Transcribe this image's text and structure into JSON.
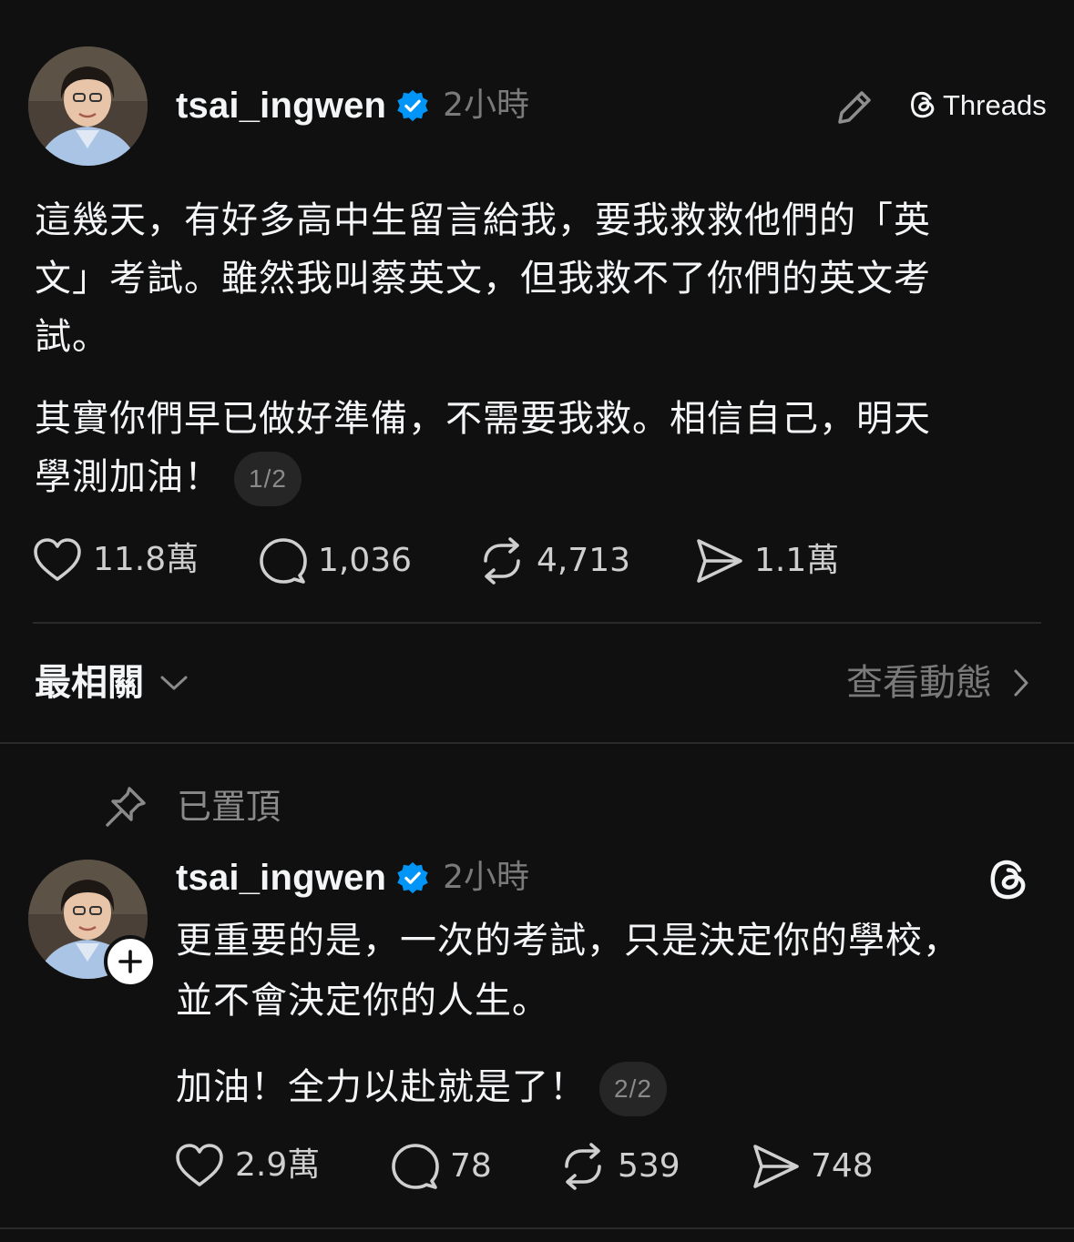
{
  "post1": {
    "username": "tsai_ingwen",
    "time": "2小時",
    "threads_label": "Threads",
    "paragraph1_lines": [
      "這幾天，有好多高中生留言給我，要我救救他們的「英",
      "文」考試。雖然我叫蔡英文，但我救不了你們的英文考",
      "試。"
    ],
    "paragraph2_lines": [
      "其實你們早已做好準備，不需要我救。相信自己，明天",
      "學測加油！"
    ],
    "counter": "1/2",
    "likes": "11.8萬",
    "replies": "1,036",
    "reposts": "4,713",
    "shares": "1.1萬"
  },
  "sort": {
    "label": "最相關",
    "activity_label": "查看動態"
  },
  "post2": {
    "pinned_label": "已置頂",
    "username": "tsai_ingwen",
    "time": "2小時",
    "paragraph1_lines": [
      "更重要的是，一次的考試，只是決定你的學校，",
      "並不會決定你的人生。"
    ],
    "paragraph2": "加油！全力以赴就是了！",
    "counter": "2/2",
    "likes": "2.9萬",
    "replies": "78",
    "reposts": "539",
    "shares": "748"
  },
  "colors": {
    "background": "#101010",
    "verified": "#0095f6",
    "text": "#f3f5f7",
    "muted": "#7a7a7a"
  },
  "icons": [
    "heart-icon",
    "comment-icon",
    "repost-icon",
    "share-icon",
    "edit-icon",
    "threads-logo-icon",
    "chevron-down-icon",
    "chevron-right-icon",
    "pin-icon",
    "follow-plus-icon",
    "verified-badge-icon"
  ]
}
